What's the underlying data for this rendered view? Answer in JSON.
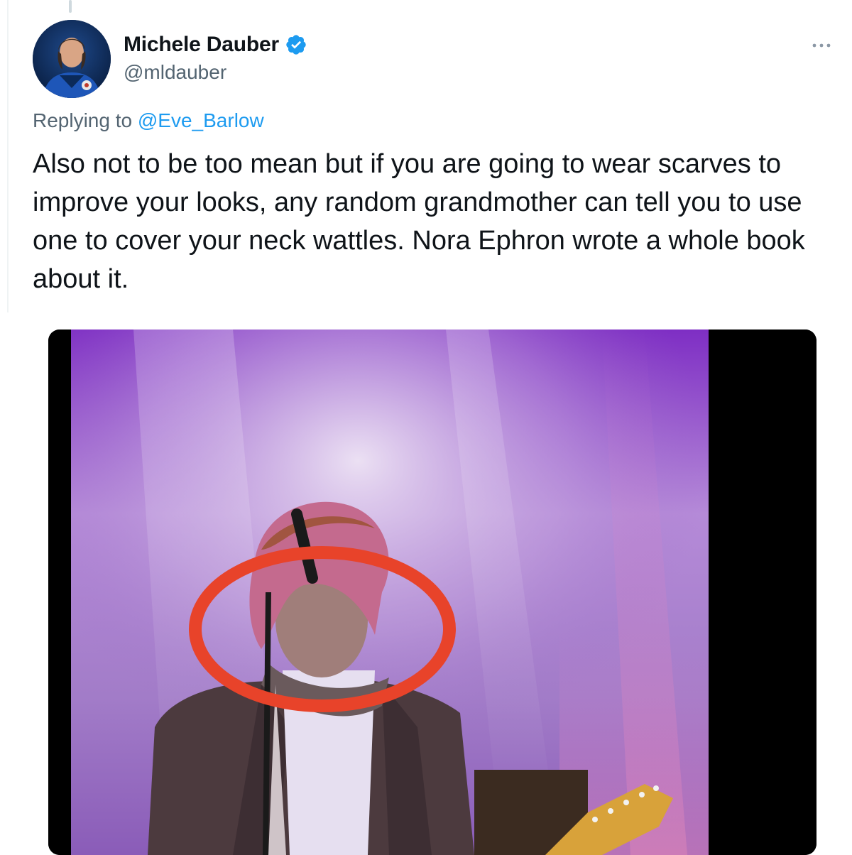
{
  "tweet": {
    "author": {
      "display_name": "Michele Dauber",
      "handle": "@mldauber",
      "verified": true
    },
    "reply": {
      "prefix": "Replying to ",
      "to_handle": "@Eve_Barlow"
    },
    "text": "Also not to be too mean but if you are going to wear scarves to improve your looks, any random grandmother can tell you to use one to cover your neck wattles. Nora Ephron wrote a whole book about it.",
    "media": {
      "type": "photo",
      "highlight_color": "#e8432a"
    }
  },
  "colors": {
    "accent": "#1d9bf0",
    "text_primary": "#0f1419",
    "text_secondary": "#536471"
  },
  "icons": {
    "verified": "verified-badge-icon",
    "more": "more-options-icon"
  }
}
